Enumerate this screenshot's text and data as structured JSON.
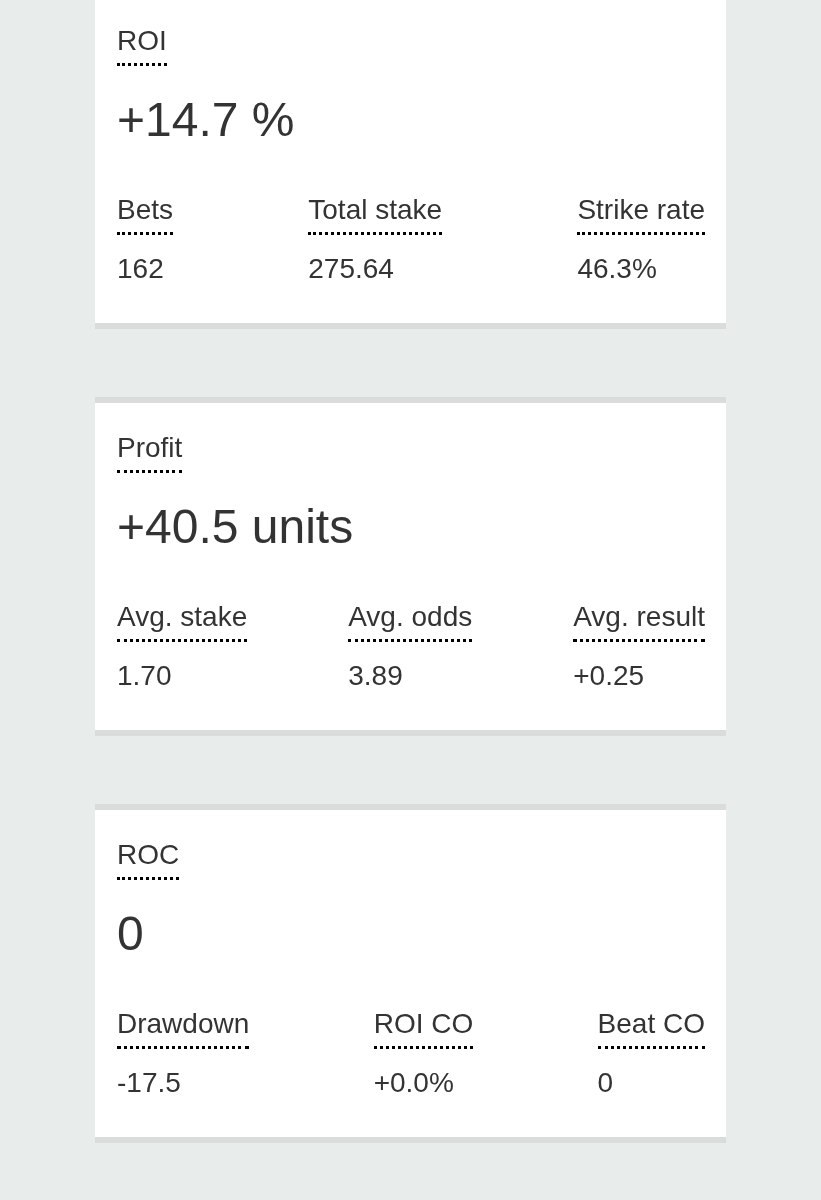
{
  "cards": [
    {
      "title": "ROI",
      "value": "+14.7 %",
      "stats": [
        {
          "label": "Bets",
          "value": "162"
        },
        {
          "label": "Total stake",
          "value": "275.64"
        },
        {
          "label": "Strike rate",
          "value": "46.3%"
        }
      ]
    },
    {
      "title": "Profit",
      "value": "+40.5 units",
      "stats": [
        {
          "label": "Avg. stake",
          "value": "1.70"
        },
        {
          "label": "Avg. odds",
          "value": "3.89"
        },
        {
          "label": "Avg. result",
          "value": "+0.25"
        }
      ]
    },
    {
      "title": "ROC",
      "value": "0",
      "stats": [
        {
          "label": "Drawdown",
          "value": "-17.5"
        },
        {
          "label": "ROI CO",
          "value": "+0.0%"
        },
        {
          "label": "Beat CO",
          "value": "0"
        }
      ]
    }
  ]
}
